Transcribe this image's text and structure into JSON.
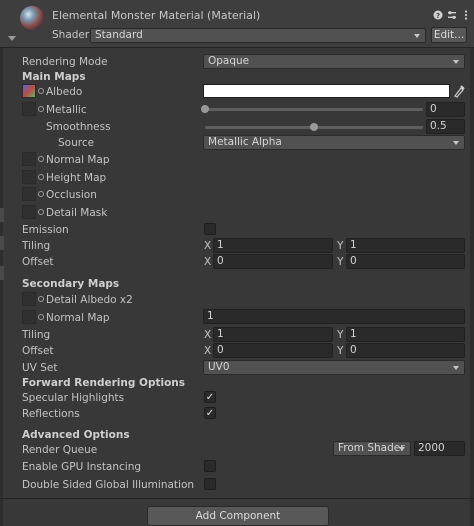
{
  "header": {
    "title": "Elemental Monster Material (Material)",
    "shader_label": "Shader",
    "shader_value": "Standard",
    "edit_button": "Edit...",
    "icons": [
      "help-icon",
      "preset-icon",
      "more-icon"
    ]
  },
  "rendering_mode": {
    "label": "Rendering Mode",
    "value": "Opaque"
  },
  "main_maps": {
    "heading": "Main Maps",
    "albedo": {
      "label": "Albedo",
      "color": "#ffffff"
    },
    "metallic": {
      "label": "Metallic",
      "value": "0",
      "fraction": 0.0
    },
    "smoothness": {
      "label": "Smoothness",
      "value": "0.5",
      "fraction": 0.5
    },
    "source": {
      "label": "Source",
      "value": "Metallic Alpha"
    },
    "normal_map": {
      "label": "Normal Map"
    },
    "height_map": {
      "label": "Height Map"
    },
    "occlusion": {
      "label": "Occlusion"
    },
    "detail_mask": {
      "label": "Detail Mask"
    },
    "emission": {
      "label": "Emission",
      "checked": false
    },
    "tiling": {
      "label": "Tiling",
      "x_label": "X",
      "x": "1",
      "y_label": "Y",
      "y": "1"
    },
    "offset": {
      "label": "Offset",
      "x_label": "X",
      "x": "0",
      "y_label": "Y",
      "y": "0"
    }
  },
  "secondary_maps": {
    "heading": "Secondary Maps",
    "detail_albedo": {
      "label": "Detail Albedo x2"
    },
    "normal_map": {
      "label": "Normal Map",
      "value": "1"
    },
    "tiling": {
      "label": "Tiling",
      "x_label": "X",
      "x": "1",
      "y_label": "Y",
      "y": "1"
    },
    "offset": {
      "label": "Offset",
      "x_label": "X",
      "x": "0",
      "y_label": "Y",
      "y": "0"
    },
    "uv_set": {
      "label": "UV Set",
      "value": "UV0"
    }
  },
  "forward_rendering": {
    "heading": "Forward Rendering Options",
    "specular_highlights": {
      "label": "Specular Highlights",
      "checked": true
    },
    "reflections": {
      "label": "Reflections",
      "checked": true
    }
  },
  "advanced": {
    "heading": "Advanced Options",
    "render_queue": {
      "label": "Render Queue",
      "mode": "From Shader",
      "value": "2000"
    },
    "gpu_instancing": {
      "label": "Enable GPU Instancing",
      "checked": false
    },
    "double_sided_gi": {
      "label": "Double Sided Global Illumination",
      "checked": false
    }
  },
  "add_component": "Add Component",
  "check_glyph": "✓",
  "picker_glyph": "✎"
}
